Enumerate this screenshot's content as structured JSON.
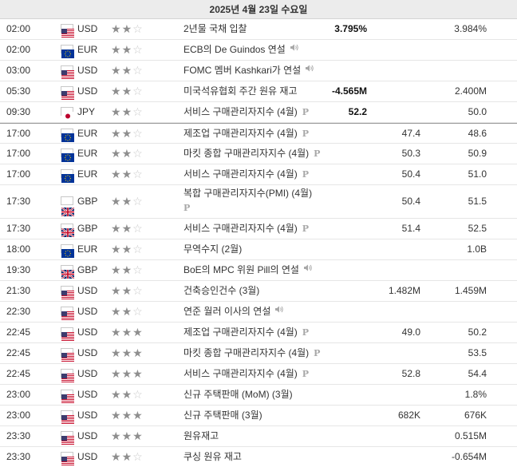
{
  "date_header": "2025년 4월 23일 수요일",
  "colors": {
    "accent_star": "#8e8e8e",
    "star_off": "#c9c9c9",
    "row_border": "#e6e6e6"
  },
  "events": [
    {
      "time": "02:00",
      "flag": "us-flag-icon",
      "currency": "USD",
      "importance": 2,
      "event": "2년물 국채 입찰",
      "marker": "",
      "actual": "3.795%",
      "forecast": "",
      "previous": "3.984%"
    },
    {
      "time": "02:00",
      "flag": "eu-flag-icon",
      "currency": "EUR",
      "importance": 2,
      "event": "ECB의 De Guindos 연설",
      "marker": "speaker",
      "actual": "",
      "forecast": "",
      "previous": ""
    },
    {
      "time": "03:00",
      "flag": "us-flag-icon",
      "currency": "USD",
      "importance": 2,
      "event": "FOMC 멤버 Kashkari가 연설",
      "marker": "speaker",
      "actual": "",
      "forecast": "",
      "previous": ""
    },
    {
      "time": "05:30",
      "flag": "us-flag-icon",
      "currency": "USD",
      "importance": 2,
      "event": "미국석유협회 주간 원유 재고",
      "marker": "",
      "actual": "-4.565M",
      "forecast": "",
      "previous": "2.400M"
    },
    {
      "time": "09:30",
      "flag": "jp-flag-icon",
      "currency": "JPY",
      "importance": 2,
      "event": "서비스 구매관리자지수 (4월)",
      "marker": "P",
      "actual": "52.2",
      "forecast": "",
      "previous": "50.0"
    },
    {
      "time": "17:00",
      "flag": "eu-flag-icon",
      "currency": "EUR",
      "importance": 2,
      "event": "제조업 구매관리자지수 (4월)",
      "marker": "P",
      "actual": "",
      "forecast": "47.4",
      "previous": "48.6",
      "separator": true
    },
    {
      "time": "17:00",
      "flag": "eu-flag-icon",
      "currency": "EUR",
      "importance": 2,
      "event": "마킷 종합 구매관리자지수 (4월)",
      "marker": "P",
      "actual": "",
      "forecast": "50.3",
      "previous": "50.9"
    },
    {
      "time": "17:00",
      "flag": "eu-flag-icon",
      "currency": "EUR",
      "importance": 2,
      "event": "서비스 구매관리자지수 (4월)",
      "marker": "P",
      "actual": "",
      "forecast": "50.4",
      "previous": "51.0"
    },
    {
      "time": "17:30",
      "flag": "gb-flag-icon",
      "currency": "GBP",
      "importance": 2,
      "event": "복합 구매관리자지수(PMI) (4월)",
      "marker": "P",
      "actual": "",
      "forecast": "50.4",
      "previous": "51.5",
      "tall": true
    },
    {
      "time": "17:30",
      "flag": "gb-flag-icon",
      "currency": "GBP",
      "importance": 2,
      "event": "서비스 구매관리자지수 (4월)",
      "marker": "P",
      "actual": "",
      "forecast": "51.4",
      "previous": "52.5"
    },
    {
      "time": "18:00",
      "flag": "eu-flag-icon",
      "currency": "EUR",
      "importance": 2,
      "event": "무역수지 (2월)",
      "marker": "",
      "actual": "",
      "forecast": "",
      "previous": "1.0B"
    },
    {
      "time": "19:30",
      "flag": "gb-flag-icon",
      "currency": "GBP",
      "importance": 2,
      "event": "BoE의 MPC 위원 Pill의 연설",
      "marker": "speaker",
      "actual": "",
      "forecast": "",
      "previous": ""
    },
    {
      "time": "21:30",
      "flag": "us-flag-icon",
      "currency": "USD",
      "importance": 2,
      "event": "건축승인건수 (3월)",
      "marker": "",
      "actual": "",
      "forecast": "1.482M",
      "previous": "1.459M"
    },
    {
      "time": "22:30",
      "flag": "us-flag-icon",
      "currency": "USD",
      "importance": 2,
      "event": "연준 월러 이사의 연설",
      "marker": "speaker",
      "actual": "",
      "forecast": "",
      "previous": ""
    },
    {
      "time": "22:45",
      "flag": "us-flag-icon",
      "currency": "USD",
      "importance": 3,
      "event": "제조업 구매관리자지수 (4월)",
      "marker": "P",
      "actual": "",
      "forecast": "49.0",
      "previous": "50.2"
    },
    {
      "time": "22:45",
      "flag": "us-flag-icon",
      "currency": "USD",
      "importance": 3,
      "event": "마킷 종합 구매관리자지수 (4월)",
      "marker": "P",
      "actual": "",
      "forecast": "",
      "previous": "53.5"
    },
    {
      "time": "22:45",
      "flag": "us-flag-icon",
      "currency": "USD",
      "importance": 3,
      "event": "서비스 구매관리자지수 (4월)",
      "marker": "P",
      "actual": "",
      "forecast": "52.8",
      "previous": "54.4"
    },
    {
      "time": "23:00",
      "flag": "us-flag-icon",
      "currency": "USD",
      "importance": 2,
      "event": "신규 주택판매 (MoM) (3월)",
      "marker": "",
      "actual": "",
      "forecast": "",
      "previous": "1.8%"
    },
    {
      "time": "23:00",
      "flag": "us-flag-icon",
      "currency": "USD",
      "importance": 3,
      "event": "신규 주택판매 (3월)",
      "marker": "",
      "actual": "",
      "forecast": "682K",
      "previous": "676K"
    },
    {
      "time": "23:30",
      "flag": "us-flag-icon",
      "currency": "USD",
      "importance": 3,
      "event": "원유재고",
      "marker": "",
      "actual": "",
      "forecast": "",
      "previous": "0.515M"
    },
    {
      "time": "23:30",
      "flag": "us-flag-icon",
      "currency": "USD",
      "importance": 2,
      "event": "쿠싱 원유 재고",
      "marker": "",
      "actual": "",
      "forecast": "",
      "previous": "-0.654M"
    }
  ]
}
